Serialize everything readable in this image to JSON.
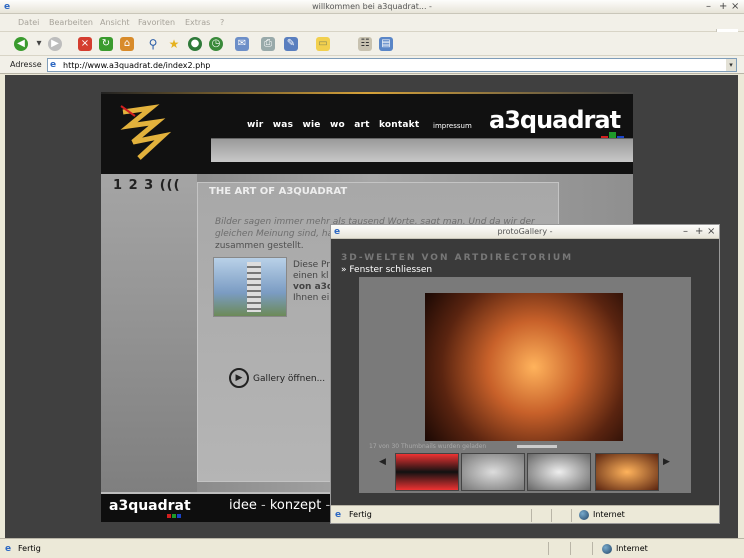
{
  "window": {
    "title": "willkommen bei a3quadrat... -",
    "buttons": [
      "–",
      "+",
      "×"
    ]
  },
  "menu": [
    "Datei",
    "Bearbeiten",
    "Ansicht",
    "Favoriten",
    "Extras",
    "?"
  ],
  "toolbar": [
    "back-icon",
    "forward-icon",
    "stop-icon",
    "refresh-icon",
    "home-icon",
    "search-icon",
    "favorites-icon",
    "media-icon",
    "history-icon",
    "mail-icon",
    "print-icon",
    "edit-icon",
    "discuss-icon",
    "messenger-icon",
    "research-icon"
  ],
  "address": {
    "label": "Adresse",
    "url": "http://www.a3quadrat.de/index2.php"
  },
  "site": {
    "nav": [
      "wir",
      "was",
      "wie",
      "wo",
      "art",
      "kontakt"
    ],
    "impressum": "impressum",
    "logo": "a3quadrat",
    "numbers": "1 2 3 (((",
    "panel_title": "THE ART OF A3QUADRAT",
    "intro": "Bilder sagen immer mehr als tausend Worte, sagt man. Und da wir der gleichen Meinung sind, ha",
    "intro2": "zusammen gestellt.",
    "desc": [
      "Diese Pr",
      "einen kl",
      "von a3q",
      "Ihnen ei"
    ],
    "gallery_link": "Gallery öffnen...",
    "bottom_logo": "a3quadrat",
    "bottom_nav": [
      "idee",
      "konzept",
      "r"
    ]
  },
  "popup": {
    "title": "protoGallery -",
    "heading": "3D-WELTEN VON ARTDIRECTORIUM",
    "close": "» Fenster schliessen",
    "status_loaded": "17 von 30 Thumbnails wurden geladen",
    "status_text": "Fertig",
    "zone": "Internet"
  },
  "statusbar": {
    "text": "Fertig",
    "zone": "Internet"
  },
  "colors": {
    "brand_red": "#d11f1f",
    "brand_green": "#1f9a2a",
    "brand_blue": "#1a44c8",
    "gold": "#d6a23a"
  }
}
